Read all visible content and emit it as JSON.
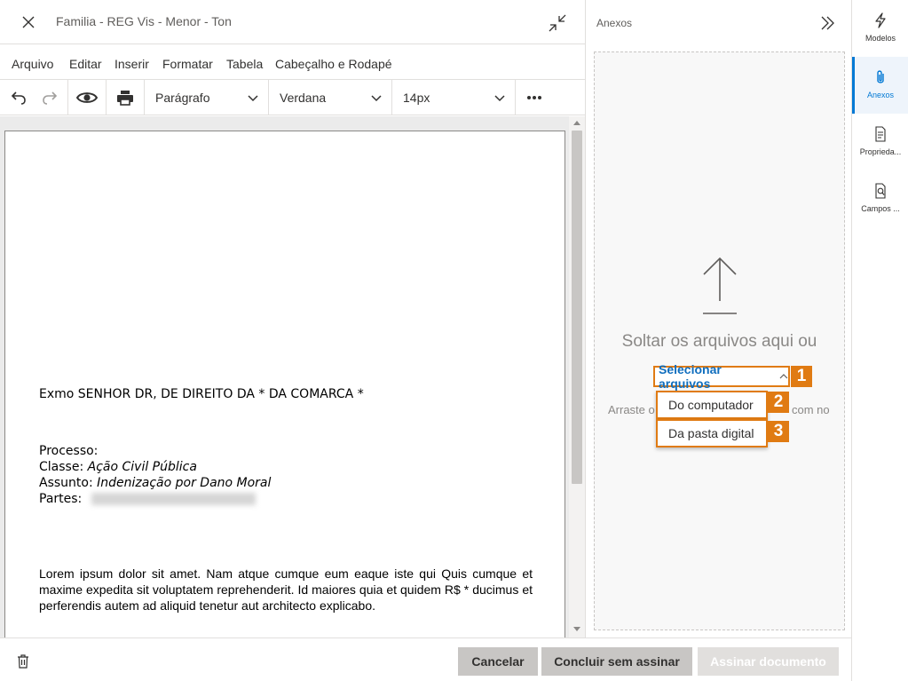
{
  "window": {
    "title": "Familia - REG Vis - Menor - Ton"
  },
  "menu": [
    "Arquivo",
    "Editar",
    "Inserir",
    "Formatar",
    "Tabela",
    "Cabeçalho e Rodapé"
  ],
  "toolbar": {
    "undo": "undo-icon",
    "redo": "redo-icon",
    "preview": "eye-icon",
    "print": "print-icon",
    "block_format": "Parágrafo",
    "font_family": "Verdana",
    "font_size": "14px",
    "more": "more-icon"
  },
  "document": {
    "addressee": "Exmo SENHOR DR, DE DIREITO DA * DA COMARCA *",
    "processo_label": "Processo:",
    "classe_label": "Classe:",
    "classe_value": "Ação Civil Pública",
    "assunto_label": "Assunto:",
    "assunto_value": "Indenização por Dano Moral",
    "partes_label": "Partes:",
    "body": "Lorem ipsum dolor sit amet.   Nam atque cumque eum eaque iste qui Quis cumque et maxime expedita sit voluptatem reprehenderit. Id maiores quia et quidem R$ * ducimus et perferendis autem ad aliquid tenetur aut architecto explicabo."
  },
  "footer": {
    "cancel": "Cancelar",
    "finish_no_sign": "Concluir sem assinar",
    "sign": "Assinar documento"
  },
  "anexos": {
    "title": "Anexos",
    "drop_text": "Soltar os arquivos aqui ou",
    "select_files": "Selecionar arquivos",
    "hint_left": "Arraste o",
    "hint_right": "com no",
    "options": [
      "Do computador",
      "Da pasta digital"
    ],
    "badges": [
      "1",
      "2",
      "3"
    ],
    "accent": "#e07b13"
  },
  "rail": [
    {
      "label": "Modelos",
      "icon": "lightning-icon",
      "active": false
    },
    {
      "label": "Anexos",
      "icon": "paperclip-icon",
      "active": true
    },
    {
      "label": "Proprieda...",
      "icon": "properties-icon",
      "active": false
    },
    {
      "label": "Campos ...",
      "icon": "search-document-icon",
      "active": false
    }
  ]
}
